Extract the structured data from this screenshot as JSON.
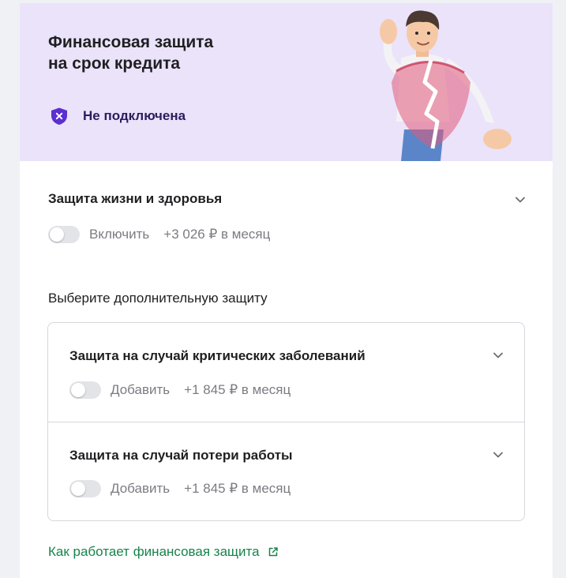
{
  "hero": {
    "title_line1": "Финансовая защита",
    "title_line2": "на срок кредита",
    "status_text": "Не подключена",
    "status_icon": "shield-x-icon",
    "background_color": "#ebe3fa"
  },
  "life": {
    "title": "Защита жизни и здоровья",
    "toggle_label": "Включить",
    "price": "+3 026 ₽ в месяц",
    "enabled": false
  },
  "extra": {
    "heading": "Выберите дополнительную защиту",
    "options": [
      {
        "title": "Защита на случай критических заболеваний",
        "toggle_label": "Добавить",
        "price": "+1 845 ₽ в месяц",
        "enabled": false
      },
      {
        "title": "Защита на случай потери работы",
        "toggle_label": "Добавить",
        "price": "+1 845 ₽ в месяц",
        "enabled": false
      }
    ]
  },
  "link": {
    "text": "Как работает финансовая защита",
    "icon": "external-link-icon",
    "color": "#17844a"
  },
  "colors": {
    "accent_purple": "#5b2fd0",
    "link_green": "#17844a"
  }
}
